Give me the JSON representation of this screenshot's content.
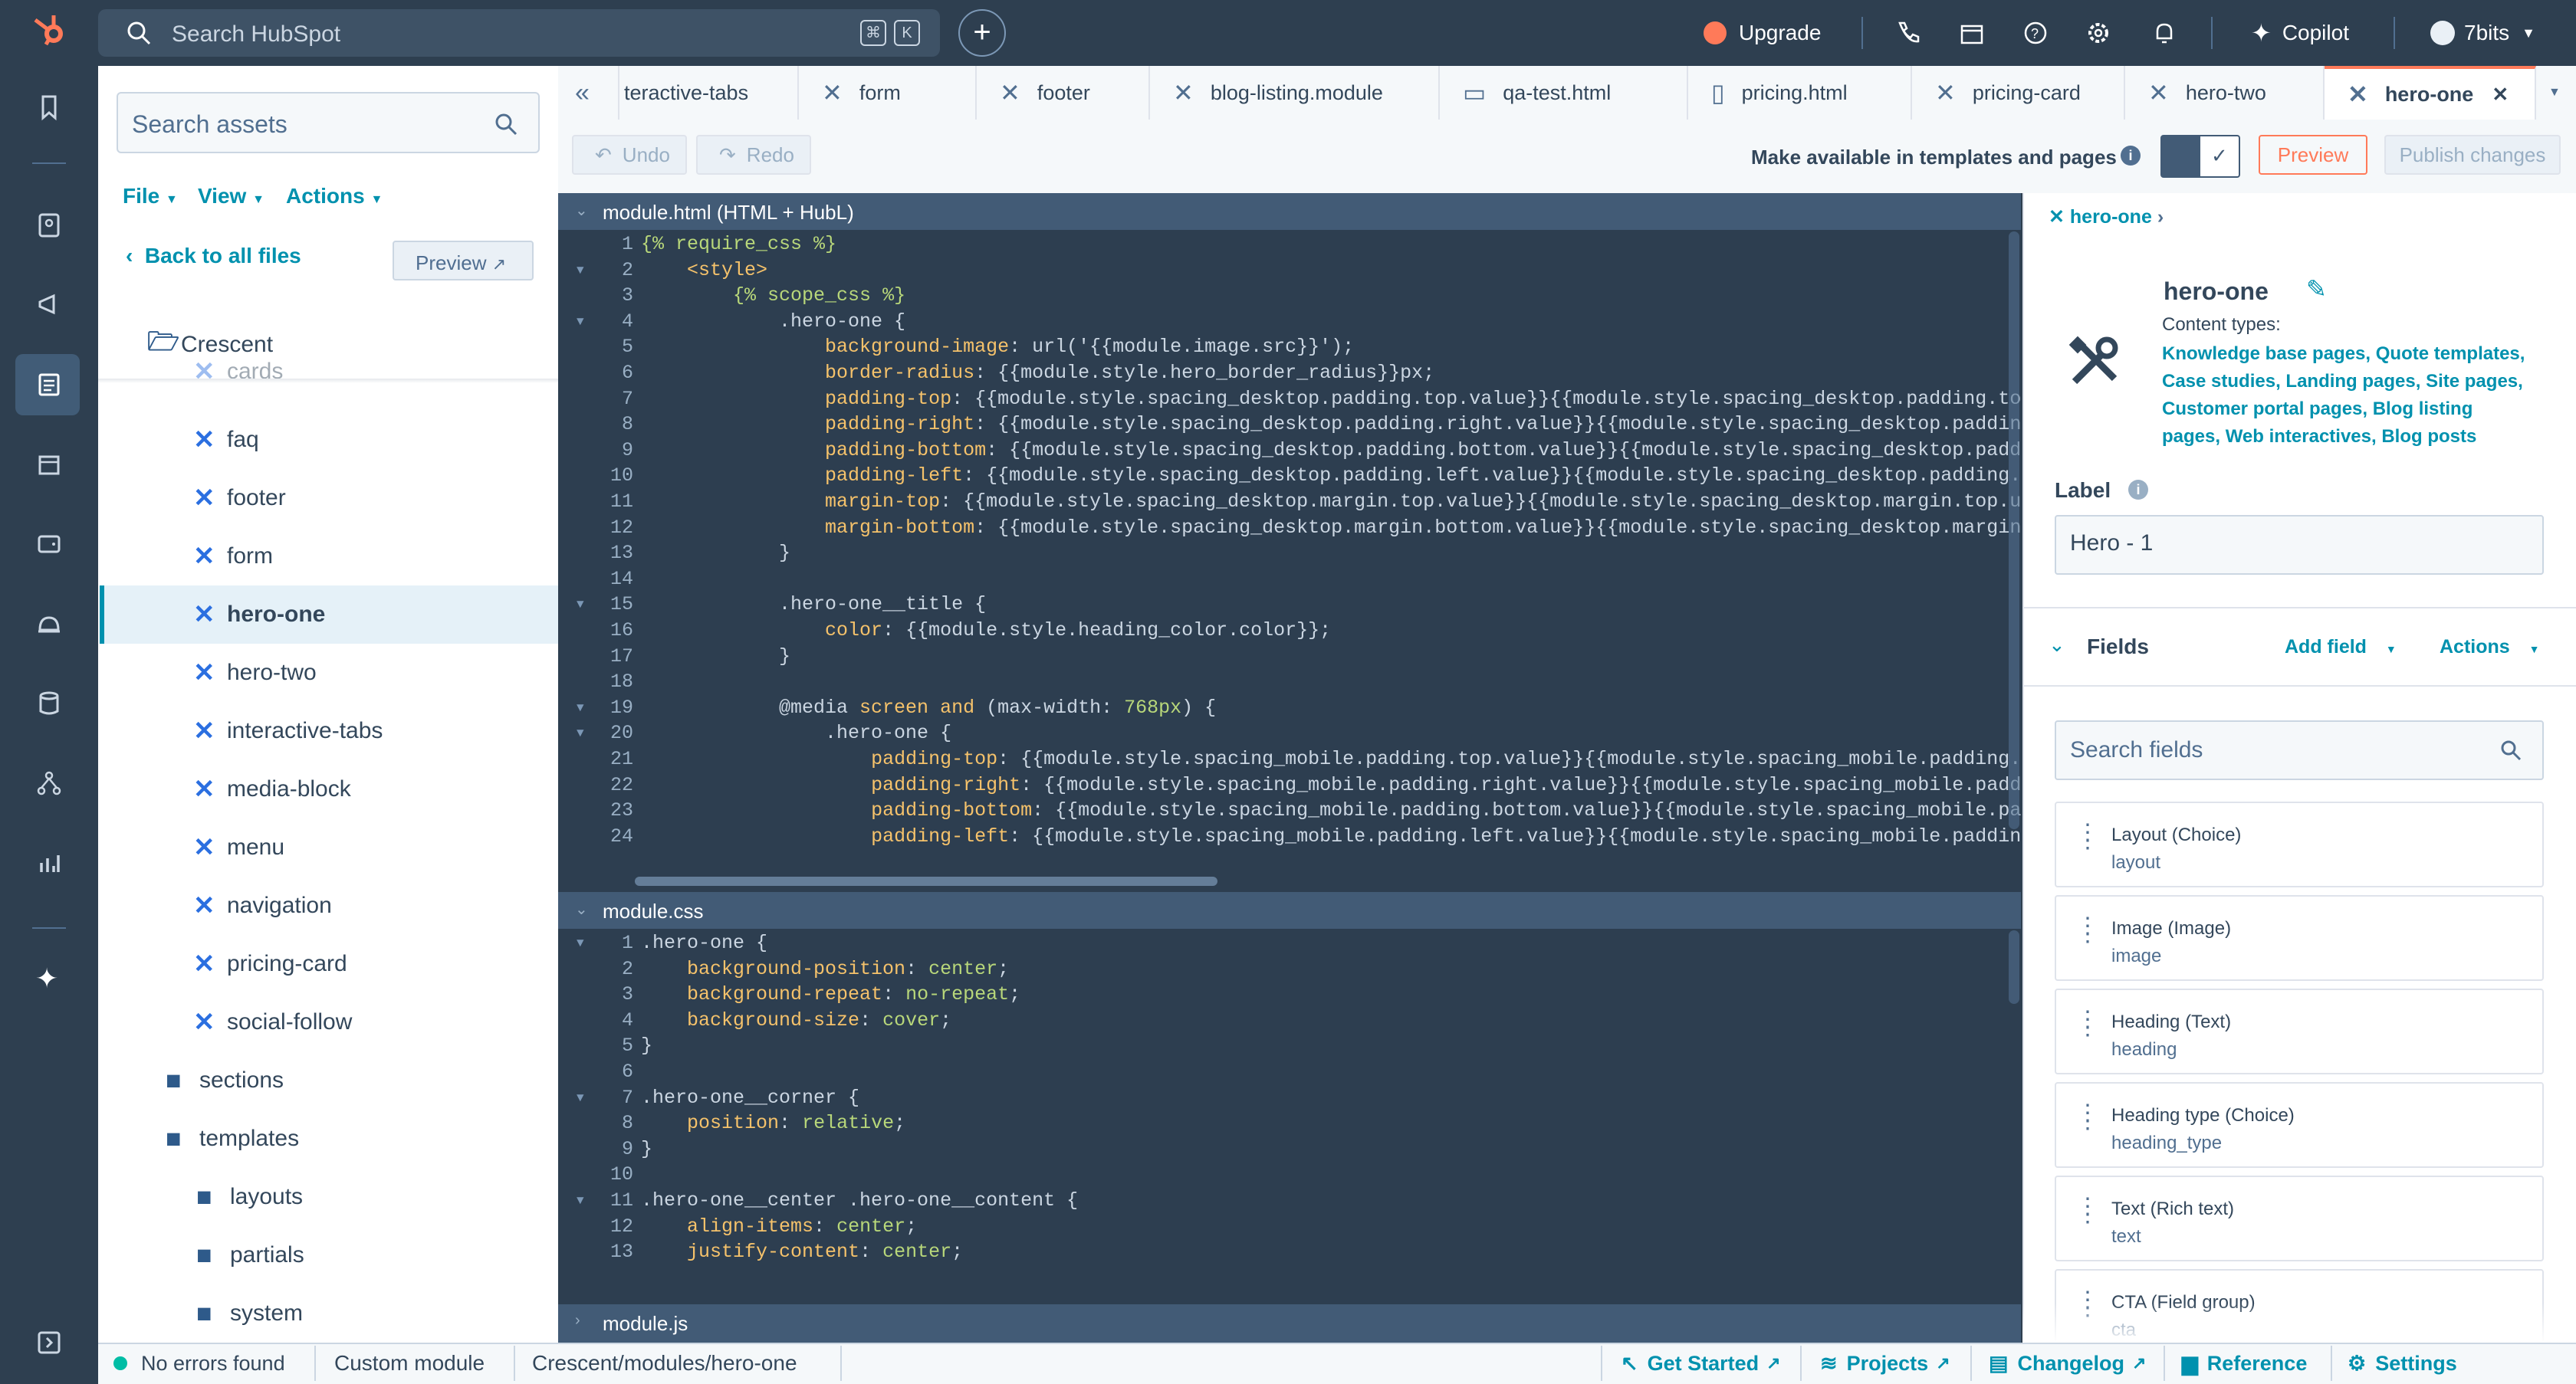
{
  "topnav": {
    "search_placeholder": "Search HubSpot",
    "kbd_cmd": "⌘",
    "kbd_k": "K",
    "upgrade": "Upgrade",
    "copilot": "Copilot",
    "account": "7bits"
  },
  "sidebar": {
    "search_placeholder": "Search assets",
    "menus": [
      "File",
      "View",
      "Actions"
    ],
    "back": "Back to all files",
    "preview": "Preview",
    "root": "Crescent",
    "partial_item": "cards",
    "modules": [
      "faq",
      "footer",
      "form",
      "hero-one",
      "hero-two",
      "interactive-tabs",
      "media-block",
      "menu",
      "navigation",
      "pricing-card",
      "social-follow"
    ],
    "folders": [
      "sections",
      "templates"
    ],
    "subfolders": [
      "layouts",
      "partials",
      "system"
    ]
  },
  "tabs": [
    {
      "label": "teractive-tabs",
      "icon": "module-icon"
    },
    {
      "label": "form",
      "icon": "module-icon"
    },
    {
      "label": "footer",
      "icon": "module-icon"
    },
    {
      "label": "blog-listing.module",
      "icon": "module-icon"
    },
    {
      "label": "qa-test.html",
      "icon": "template-icon"
    },
    {
      "label": "pricing.html",
      "icon": "page-icon"
    },
    {
      "label": "pricing-card",
      "icon": "module-icon"
    },
    {
      "label": "hero-two",
      "icon": "module-icon"
    },
    {
      "label": "hero-one",
      "icon": "module-icon"
    }
  ],
  "toolbar": {
    "undo": "Undo",
    "redo": "Redo",
    "available_label": "Make available in templates and pages",
    "preview": "Preview",
    "publish": "Publish changes"
  },
  "panes": {
    "html_title": "module.html (HTML + HubL)",
    "css_title": "module.css",
    "js_title": "module.js"
  },
  "html_code": [
    "{% require_css %}",
    "    <style>",
    "        {% scope_css %}",
    "            .hero-one {",
    "                background-image: url('{{module.image.src}}');",
    "                border-radius: {{module.style.hero_border_radius}}px;",
    "                padding-top: {{module.style.spacing_desktop.padding.top.value}}{{module.style.spacing_desktop.padding.top.un",
    "                padding-right: {{module.style.spacing_desktop.padding.right.value}}{{module.style.spacing_desktop.padding.ri",
    "                padding-bottom: {{module.style.spacing_desktop.padding.bottom.value}}{{module.style.spacing_desktop.padding.",
    "                padding-left: {{module.style.spacing_desktop.padding.left.value}}{{module.style.spacing_desktop.padding.left",
    "                margin-top: {{module.style.spacing_desktop.margin.top.value}}{{module.style.spacing_desktop.margin.top.units",
    "                margin-bottom: {{module.style.spacing_desktop.margin.bottom.value}}{{module.style.spacing_desktop.margin.bot",
    "            }",
    "",
    "            .hero-one__title {",
    "                color: {{module.style.heading_color.color}};",
    "            }",
    "",
    "            @media screen and (max-width: 768px) {",
    "                .hero-one {",
    "                    padding-top: {{module.style.spacing_mobile.padding.top.value}}{{module.style.spacing_mobile.padding.top.u",
    "                    padding-right: {{module.style.spacing_mobile.padding.right.value}}{{module.style.spacing_mobile.padding.r",
    "                    padding-bottom: {{module.style.spacing_mobile.padding.bottom.value}}{{module.style.spacing_mobile.padding",
    "                    padding-left: {{module.style.spacing_mobile.padding.left.value}}{{module.style.spacing_mobile.padding.lef"
  ],
  "css_code": [
    ".hero-one {",
    "    background-position: center;",
    "    background-repeat: no-repeat;",
    "    background-size: cover;",
    "}",
    "",
    ".hero-one__corner {",
    "    position: relative;",
    "}",
    "",
    ".hero-one__center .hero-one__content {",
    "    align-items: center;",
    "    justify-content: center;"
  ],
  "right": {
    "breadcrumb": "hero-one",
    "title": "hero-one",
    "content_types_label": "Content types:",
    "content_types": [
      "Knowledge base pages, Quote templates,",
      "Case studies, Landing pages, Site pages,",
      "Customer portal pages, Blog listing",
      "pages, Web interactives, Blog posts"
    ],
    "label_title": "Label",
    "label_value": "Hero - 1",
    "fields_title": "Fields",
    "add_field": "Add field",
    "actions": "Actions",
    "search_fields": "Search fields",
    "fields": [
      {
        "label": "Layout (Choice)",
        "name": "layout"
      },
      {
        "label": "Image (Image)",
        "name": "image"
      },
      {
        "label": "Heading (Text)",
        "name": "heading"
      },
      {
        "label": "Heading type (Choice)",
        "name": "heading_type"
      },
      {
        "label": "Text (Rich text)",
        "name": "text"
      },
      {
        "label": "CTA (Field group)",
        "name": "cta"
      }
    ]
  },
  "footer": {
    "status": "No errors found",
    "type": "Custom module",
    "path": "Crescent/modules/hero-one",
    "links": [
      "Get Started",
      "Projects",
      "Changelog",
      "Reference",
      "Settings"
    ]
  },
  "colors": {
    "accent": "#ff7a59",
    "link": "#0091ae",
    "nav": "#2e3f50",
    "editor": "#2d3e50"
  }
}
